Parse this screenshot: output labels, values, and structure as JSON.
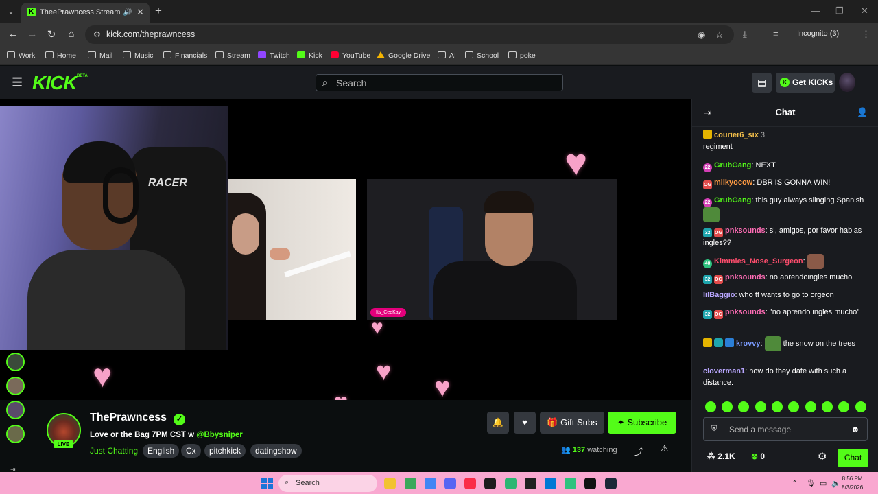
{
  "browser": {
    "tab_title": "TheePrawncess Stream - Wa",
    "url": "kick.com/theprawncess",
    "incognito_label": "Incognito (3)",
    "bookmarks": [
      "Work",
      "Home",
      "Mail",
      "Music",
      "Financials",
      "Stream",
      "Twitch",
      "Kick",
      "YouTube",
      "Google Drive",
      "AI",
      "School",
      "poke"
    ]
  },
  "header": {
    "logo": "KICK",
    "logo_badge": "BETA",
    "search_placeholder": "Search",
    "get_kicks_label": "Get KICKs"
  },
  "stream": {
    "name_tag": "Its_CeeKay"
  },
  "channel": {
    "name": "ThePrawncess",
    "live_label": "LIVE",
    "title": "Love or the Bag 7PM CST w",
    "title_mention": "@Bbysniper",
    "category": "Just Chatting",
    "tags": [
      "English",
      "Cx",
      "pitchkick",
      "datingshow"
    ],
    "viewers": "137",
    "viewers_label": "watching",
    "gift_subs_label": "Gift Subs",
    "subscribe_label": "Subscribe"
  },
  "chat": {
    "title": "Chat",
    "messages": [
      {
        "user": "courier6_six",
        "badges": [
          "gold"
        ],
        "suffix": " 3",
        "text": "regiment",
        "color": "#f5c04a"
      },
      {
        "user": "GrubGang",
        "badges": [
          "sub22"
        ],
        "text": "NEXT",
        "color": "#53fc18"
      },
      {
        "user": "milkyocow",
        "badges": [
          "og"
        ],
        "text": "DBR IS GONNA WIN!",
        "color": "#ff9b43"
      },
      {
        "user": "GrubGang",
        "badges": [
          "sub22"
        ],
        "text": "this guy always slinging Spanish",
        "color": "#53fc18"
      },
      {
        "user": "pnksounds",
        "badges": [
          "32",
          "og"
        ],
        "text": "si, amigos, por favor hablas ingles??",
        "color": "#ff6cb5"
      },
      {
        "user": "Kimmies_Nose_Surgeon",
        "badges": [
          "40"
        ],
        "text": "",
        "color": "#ff4d6d"
      },
      {
        "user": "pnksounds",
        "badges": [
          "32",
          "og"
        ],
        "text": "no aprendoingles mucho",
        "color": "#ff6cb5"
      },
      {
        "user": "lilBaggio",
        "badges": [],
        "text": "who tf wants to go to orgeon",
        "color": "#b9a7ff"
      },
      {
        "user": "pnksounds",
        "badges": [
          "32",
          "og"
        ],
        "text": "\"no aprendo ingles mucho\"",
        "color": "#ff6cb5"
      },
      {
        "user": "krovvy",
        "badges": [
          "gold",
          "tier",
          "blue"
        ],
        "text": "the snow on the trees",
        "color": "#7b9cff"
      },
      {
        "user": "cloverman1",
        "badges": [],
        "text": "how do they date with such a distance.",
        "color": "#b9a7ff"
      }
    ],
    "input_placeholder": "Send a message",
    "kicks_count": "2.1K",
    "points": "0",
    "chat_button": "Chat"
  },
  "taskbar": {
    "search_label": "Search",
    "time": "8:56 PM",
    "date": "8/3/2026"
  },
  "colors": {
    "brand": "#53fc18",
    "taskbar": "#f9a8d0"
  }
}
